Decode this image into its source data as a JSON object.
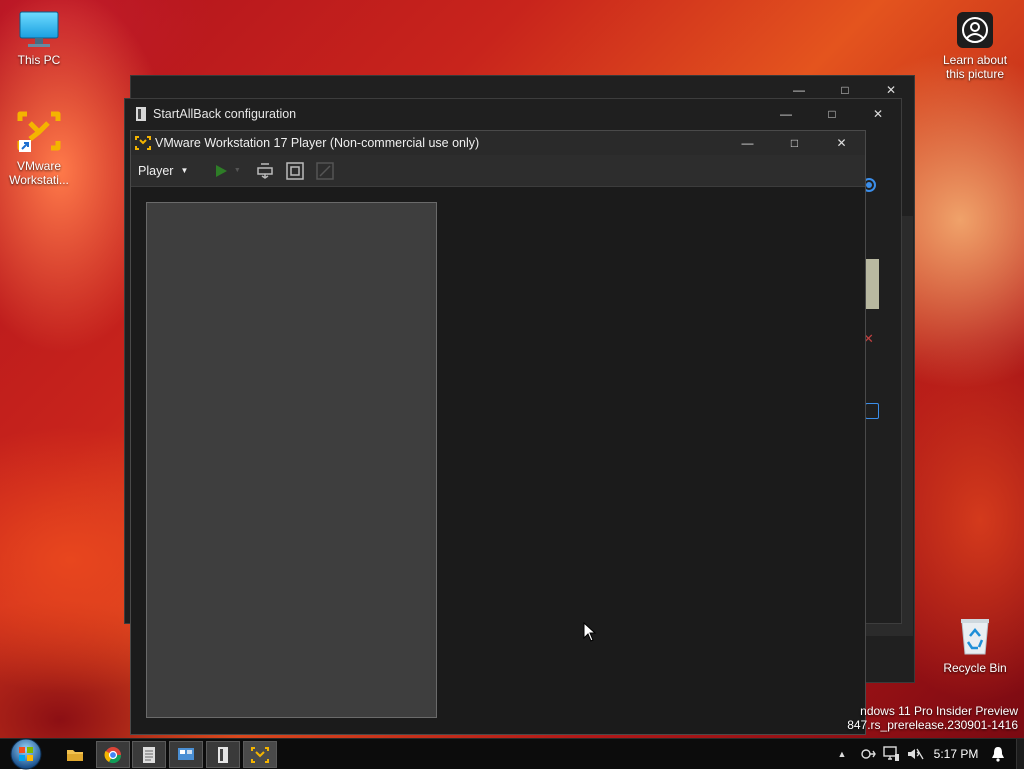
{
  "desktop": {
    "icons": [
      {
        "name": "this-pc",
        "label": "This PC",
        "icon": "monitor-icon"
      },
      {
        "name": "vmware-workstation",
        "label": "VMware Workstati...",
        "icon": "vmware-logo-icon"
      },
      {
        "name": "learn-about-picture",
        "label": "Learn about this picture",
        "icon": "camera-circle-icon"
      },
      {
        "name": "recycle-bin",
        "label": "Recycle Bin",
        "icon": "recycle-bin-icon"
      }
    ],
    "watermark": {
      "line1": "ndows 11 Pro Insider Preview",
      "line2": "847.rs_prerelease.230901-1416"
    }
  },
  "windows": {
    "startallback": {
      "title": "StartAllBack configuration"
    },
    "vmware": {
      "title": "VMware Workstation 17 Player (Non-commercial use only)",
      "menu_label": "Player"
    }
  },
  "taskbar": {
    "apps": [
      "start-orb-icon",
      "file-explorer-icon",
      "chrome-icon",
      "notepad-icon",
      "control-panel-icon",
      "startallback-icon",
      "vmware-icon"
    ],
    "tray": [
      "chevron-up-icon",
      "usb-icon",
      "network-icon",
      "volume-muted-icon"
    ],
    "time": "5:17 PM"
  },
  "colors": {
    "accent": "#3b8eea",
    "vmware_orange": "#f4b400",
    "play_green": "#3ea832"
  }
}
